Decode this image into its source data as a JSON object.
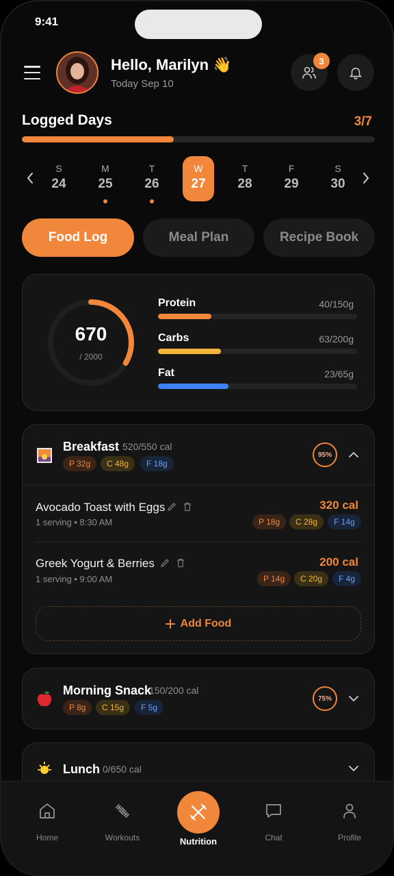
{
  "status": {
    "time": "9:41"
  },
  "header": {
    "greeting": "Hello, Marilyn 👋",
    "date": "Today Sep 10",
    "friends_badge": "3"
  },
  "logged": {
    "title": "Logged Days",
    "count": "3/7",
    "progress": 0.43
  },
  "calendar": {
    "days": [
      {
        "name": "S",
        "num": "24",
        "logged": false,
        "active": false
      },
      {
        "name": "M",
        "num": "25",
        "logged": true,
        "active": false
      },
      {
        "name": "T",
        "num": "26",
        "logged": true,
        "active": false
      },
      {
        "name": "W",
        "num": "27",
        "logged": false,
        "active": true
      },
      {
        "name": "T",
        "num": "28",
        "logged": false,
        "active": false
      },
      {
        "name": "F",
        "num": "29",
        "logged": false,
        "active": false
      },
      {
        "name": "S",
        "num": "30",
        "logged": false,
        "active": false
      }
    ]
  },
  "tabs": [
    {
      "label": "Food Log",
      "active": true
    },
    {
      "label": "Meal Plan",
      "active": false
    },
    {
      "label": "Recipe Book",
      "active": false
    }
  ],
  "summary": {
    "calories": "670",
    "goal": "/ 2000",
    "calorie_fraction": 0.335,
    "macros": [
      {
        "label": "Protein",
        "value": "40/150g",
        "fraction": 0.267,
        "color": "#f0873a"
      },
      {
        "label": "Carbs",
        "value": "63/200g",
        "fraction": 0.315,
        "color": "#f2b53a"
      },
      {
        "label": "Fat",
        "value": "23/65g",
        "fraction": 0.354,
        "color": "#3b82f6"
      }
    ]
  },
  "breakfast": {
    "title": "Breakfast",
    "cal": "520/550 cal",
    "p": "P 32g",
    "c": "C 48g",
    "f": "F 18g",
    "pct": "95%",
    "foods": [
      {
        "name": "Avocado Toast with Eggs",
        "sub": "1 serving • 8:30 AM",
        "cal": "320 cal",
        "p": "P 18g",
        "c": "C 28g",
        "f": "F 14g"
      },
      {
        "name": "Greek Yogurt & Berries",
        "sub": "1 serving • 9:00 AM",
        "cal": "200 cal",
        "p": "P 14g",
        "c": "C 20g",
        "f": "F 4g"
      }
    ],
    "add_label": "Add Food"
  },
  "snack": {
    "title": "Morning Snack",
    "cal": "150/200 cal",
    "p": "P 8g",
    "c": "C 15g",
    "f": "F 5g",
    "pct": "75%"
  },
  "lunch": {
    "title": "Lunch",
    "cal": "0/650 cal"
  },
  "nav": [
    {
      "label": "Home"
    },
    {
      "label": "Workouts"
    },
    {
      "label": "Nutrition"
    },
    {
      "label": "Chat"
    },
    {
      "label": "Profile"
    }
  ]
}
